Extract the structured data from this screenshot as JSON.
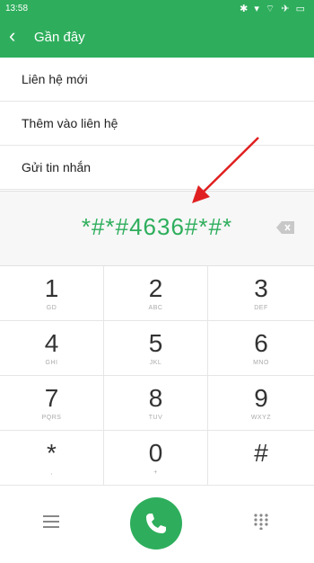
{
  "status_bar": {
    "time": "13:58",
    "icons": "✱ ▾ ⌔ ✈ ▭"
  },
  "app_bar": {
    "title": "Gần đây"
  },
  "menu": {
    "items": [
      {
        "label": "Liên hệ mới"
      },
      {
        "label": "Thêm vào liên hệ"
      },
      {
        "label": "Gửi tin nhắn"
      }
    ]
  },
  "dialer": {
    "number": "*#*#4636#*#*"
  },
  "keypad": {
    "keys": [
      {
        "digit": "1",
        "letters": "GD"
      },
      {
        "digit": "2",
        "letters": "ABC"
      },
      {
        "digit": "3",
        "letters": "DEF"
      },
      {
        "digit": "4",
        "letters": "GHI"
      },
      {
        "digit": "5",
        "letters": "JKL"
      },
      {
        "digit": "6",
        "letters": "MNO"
      },
      {
        "digit": "7",
        "letters": "PQRS"
      },
      {
        "digit": "8",
        "letters": "TUV"
      },
      {
        "digit": "9",
        "letters": "WXYZ"
      },
      {
        "digit": "*",
        "letters": ","
      },
      {
        "digit": "0",
        "letters": "+"
      },
      {
        "digit": "#",
        "letters": ""
      }
    ]
  },
  "colors": {
    "accent": "#2eae5c",
    "arrow": "#e02020"
  },
  "icons": {
    "back": "chevron-left-icon",
    "backspace": "backspace-icon",
    "menu": "menu-icon",
    "call": "phone-icon",
    "dialpad": "dialpad-icon"
  }
}
